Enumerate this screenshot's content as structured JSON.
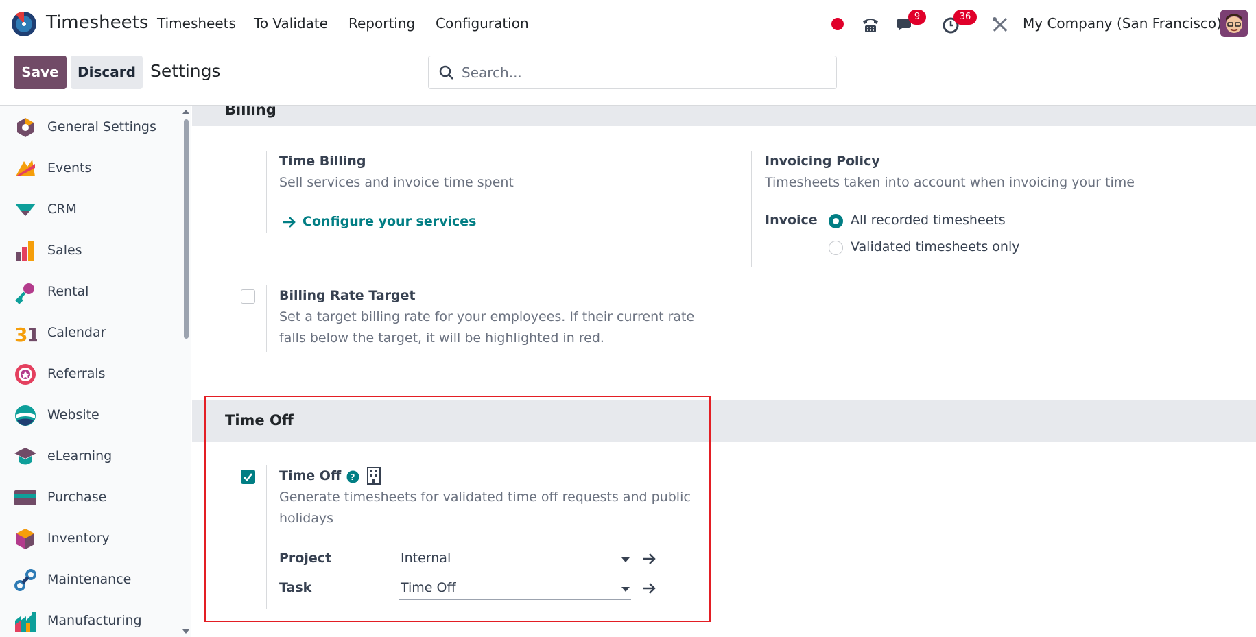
{
  "topbar": {
    "app_name": "Timesheets",
    "menus": [
      "Timesheets",
      "To Validate",
      "Reporting",
      "Configuration"
    ],
    "messages_badge": "9",
    "activity_badge": "36",
    "company": "My Company (San Francisco)"
  },
  "control": {
    "save_label": "Save",
    "discard_label": "Discard",
    "breadcrumb": "Settings",
    "search_placeholder": "Search..."
  },
  "sidebar": {
    "items": [
      {
        "label": "General Settings",
        "icon": "general-settings-icon"
      },
      {
        "label": "Events",
        "icon": "events-icon"
      },
      {
        "label": "CRM",
        "icon": "crm-icon"
      },
      {
        "label": "Sales",
        "icon": "sales-icon"
      },
      {
        "label": "Rental",
        "icon": "rental-icon"
      },
      {
        "label": "Calendar",
        "icon": "calendar-icon"
      },
      {
        "label": "Referrals",
        "icon": "referrals-icon"
      },
      {
        "label": "Website",
        "icon": "website-icon"
      },
      {
        "label": "eLearning",
        "icon": "elearning-icon"
      },
      {
        "label": "Purchase",
        "icon": "purchase-icon"
      },
      {
        "label": "Inventory",
        "icon": "inventory-icon"
      },
      {
        "label": "Maintenance",
        "icon": "maintenance-icon"
      },
      {
        "label": "Manufacturing",
        "icon": "manufacturing-icon"
      }
    ]
  },
  "billing": {
    "section_title": "Billing",
    "time_billing": {
      "title": "Time Billing",
      "desc": "Sell services and invoice time spent",
      "link": "Configure your services"
    },
    "invoicing_policy": {
      "title": "Invoicing Policy",
      "desc": "Timesheets taken into account when invoicing your time",
      "field_label": "Invoice",
      "options": [
        "All recorded timesheets",
        "Validated timesheets only"
      ],
      "selected": "All recorded timesheets"
    },
    "billing_rate": {
      "title": "Billing Rate Target",
      "desc_line1": "Set a target billing rate for your employees. If their current rate",
      "desc_line2": "falls below the target, it will be highlighted in red.",
      "checked": false
    }
  },
  "time_off": {
    "section_title": "Time Off",
    "setting_title": "Time Off",
    "checked": true,
    "desc_line1": "Generate timesheets for validated time off requests and public",
    "desc_line2": "holidays",
    "project_label": "Project",
    "project_value": "Internal",
    "task_label": "Task",
    "task_value": "Time Off"
  },
  "colors": {
    "brand": "#714b67",
    "accent": "#017e84",
    "badge": "#e0002a",
    "highlight": "#e31e24"
  }
}
